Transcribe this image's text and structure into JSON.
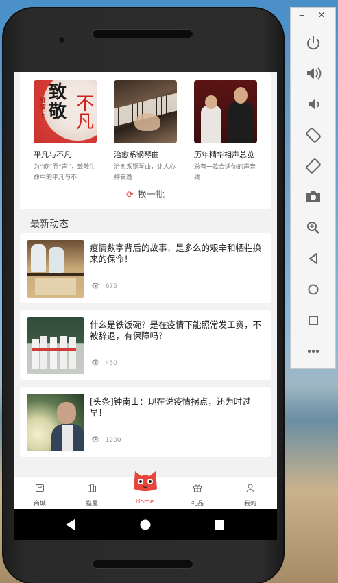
{
  "reco": {
    "items": [
      {
        "title": "平凡与不凡",
        "desc": "为“疫”而“声”，致敬生命中的平凡与不",
        "cover_text": "致敬",
        "cover_sub": "疫情下",
        "cover_side": "不凡"
      },
      {
        "title": "治愈系钢琴曲",
        "desc": "治愈系钢琴曲，让人心神安逸"
      },
      {
        "title": "历年精华相声总览",
        "desc": "总有一款合适你的声音线"
      }
    ],
    "refresh_label": "换一批"
  },
  "section_title": "最新动态",
  "news": [
    {
      "title": "疫情数字背后的故事，是多么的艰辛和牺牲换来的保命！",
      "views": "675"
    },
    {
      "title": "什么是铁饭碗？是在疫情下能照常发工资，不被辞退，有保障吗？",
      "views": "450"
    },
    {
      "title": "[头条]钟南山：现在说疫情拐点，还为时过早！",
      "views": "1200"
    }
  ],
  "tabs": [
    {
      "label": "商城",
      "icon": "mall-icon"
    },
    {
      "label": "猫屋",
      "icon": "cat-house-icon"
    },
    {
      "label": "Home",
      "icon": "cat-logo-icon"
    },
    {
      "label": "礼品",
      "icon": "gift-icon"
    },
    {
      "label": "我的",
      "icon": "user-icon"
    }
  ],
  "accent": "#e8463a",
  "emulator_panel": [
    "power-icon",
    "volume-up-icon",
    "volume-down-icon",
    "rotate-left-icon",
    "rotate-right-icon",
    "camera-icon",
    "zoom-icon",
    "back-icon",
    "home-icon",
    "overview-icon",
    "more-icon"
  ]
}
